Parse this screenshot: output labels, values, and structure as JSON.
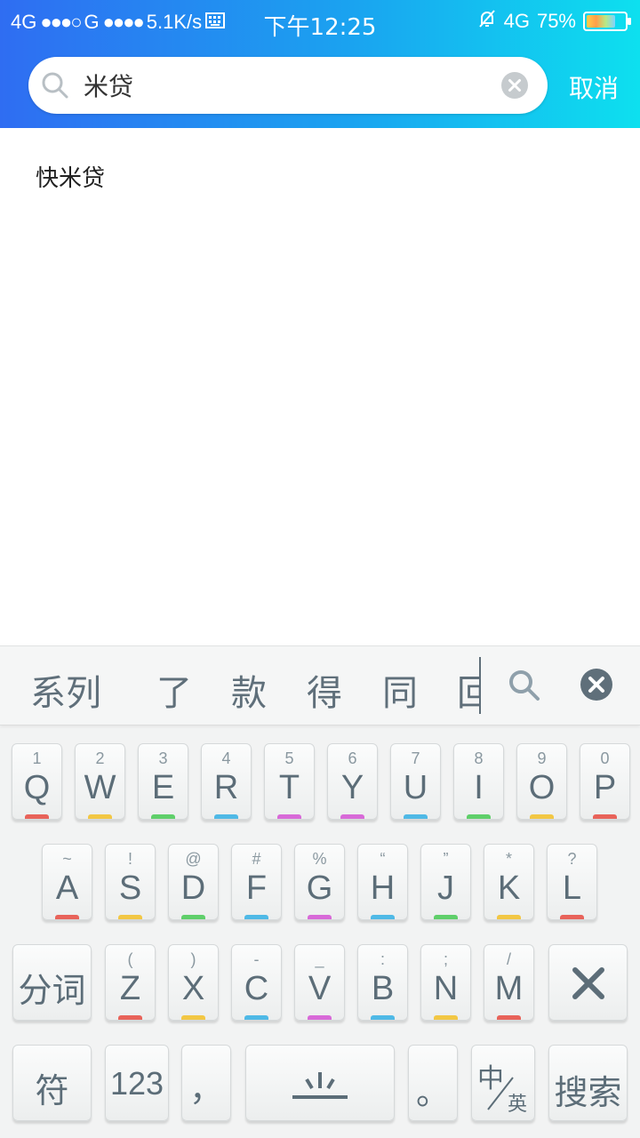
{
  "status_bar": {
    "left_net1": "4G",
    "left_net2": "G",
    "speed": "5.1K/s",
    "time": "下午12:25",
    "right_net": "4G",
    "battery": "75%",
    "battery_level": 0.75
  },
  "search": {
    "query": "米贷",
    "cancel_label": "取消"
  },
  "results": [
    {
      "label": "快米贷"
    }
  ],
  "keyboard": {
    "candidates": [
      "系列",
      "了",
      "款",
      "得",
      "同",
      "回"
    ],
    "row1": [
      {
        "main": "Q",
        "sub": "1",
        "color": "#e8635a"
      },
      {
        "main": "W",
        "sub": "2",
        "color": "#f2c744"
      },
      {
        "main": "E",
        "sub": "3",
        "color": "#5fcf6a"
      },
      {
        "main": "R",
        "sub": "4",
        "color": "#4fb9e6"
      },
      {
        "main": "T",
        "sub": "5",
        "color": "#d86ad8"
      },
      {
        "main": "Y",
        "sub": "6",
        "color": "#d86ad8"
      },
      {
        "main": "U",
        "sub": "7",
        "color": "#4fb9e6"
      },
      {
        "main": "I",
        "sub": "8",
        "color": "#5fcf6a"
      },
      {
        "main": "O",
        "sub": "9",
        "color": "#f2c744"
      },
      {
        "main": "P",
        "sub": "0",
        "color": "#e8635a"
      }
    ],
    "row2": [
      {
        "main": "A",
        "sub": "~",
        "color": "#e8635a"
      },
      {
        "main": "S",
        "sub": "!",
        "color": "#f2c744"
      },
      {
        "main": "D",
        "sub": "@",
        "color": "#5fcf6a"
      },
      {
        "main": "F",
        "sub": "#",
        "color": "#4fb9e6"
      },
      {
        "main": "G",
        "sub": "%",
        "color": "#d86ad8"
      },
      {
        "main": "H",
        "sub": "“",
        "color": "#4fb9e6"
      },
      {
        "main": "J",
        "sub": "”",
        "color": "#5fcf6a"
      },
      {
        "main": "K",
        "sub": "*",
        "color": "#f2c744"
      },
      {
        "main": "L",
        "sub": "?",
        "color": "#e8635a"
      }
    ],
    "row3_left": "分词",
    "row3": [
      {
        "main": "Z",
        "sub": "(",
        "color": "#e8635a"
      },
      {
        "main": "X",
        "sub": ")",
        "color": "#f2c744"
      },
      {
        "main": "C",
        "sub": "-",
        "color": "#4fb9e6"
      },
      {
        "main": "V",
        "sub": "_",
        "color": "#d86ad8"
      },
      {
        "main": "B",
        "sub": ":",
        "color": "#4fb9e6"
      },
      {
        "main": "N",
        "sub": ";",
        "color": "#f2c744"
      },
      {
        "main": "M",
        "sub": "/",
        "color": "#e8635a"
      }
    ],
    "symbol_key": "符",
    "numbers_key": "123",
    "comma_key": "，",
    "period_key": "。",
    "lang_key_top": "中",
    "lang_key_bottom": "英",
    "search_key": "搜索"
  }
}
